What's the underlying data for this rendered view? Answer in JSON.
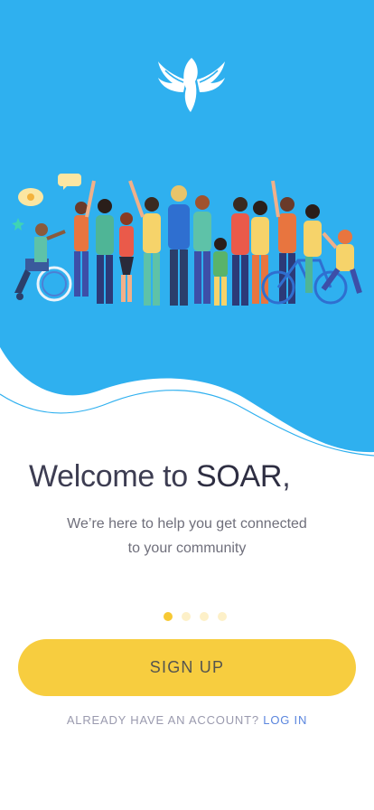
{
  "colors": {
    "sky": "#2fb0ef",
    "accent_yellow": "#f7cd3f",
    "link": "#5b86de",
    "dot_inactive": "#fdf0c8"
  },
  "hero": {
    "logo_icon": "soar-dove-icon",
    "illustration": "community-crowd-illustration"
  },
  "welcome": {
    "prefix": "Welcome to ",
    "brand": "SOAR",
    "suffix": ",",
    "subtitle_line1": "We’re here to help you get connected",
    "subtitle_line2": "to your community"
  },
  "pager": {
    "count": 4,
    "active_index": 0
  },
  "actions": {
    "signup_label": "SIGN UP",
    "have_account_text": "ALREADY HAVE AN ACCOUNT?",
    "login_label": "LOG IN"
  }
}
